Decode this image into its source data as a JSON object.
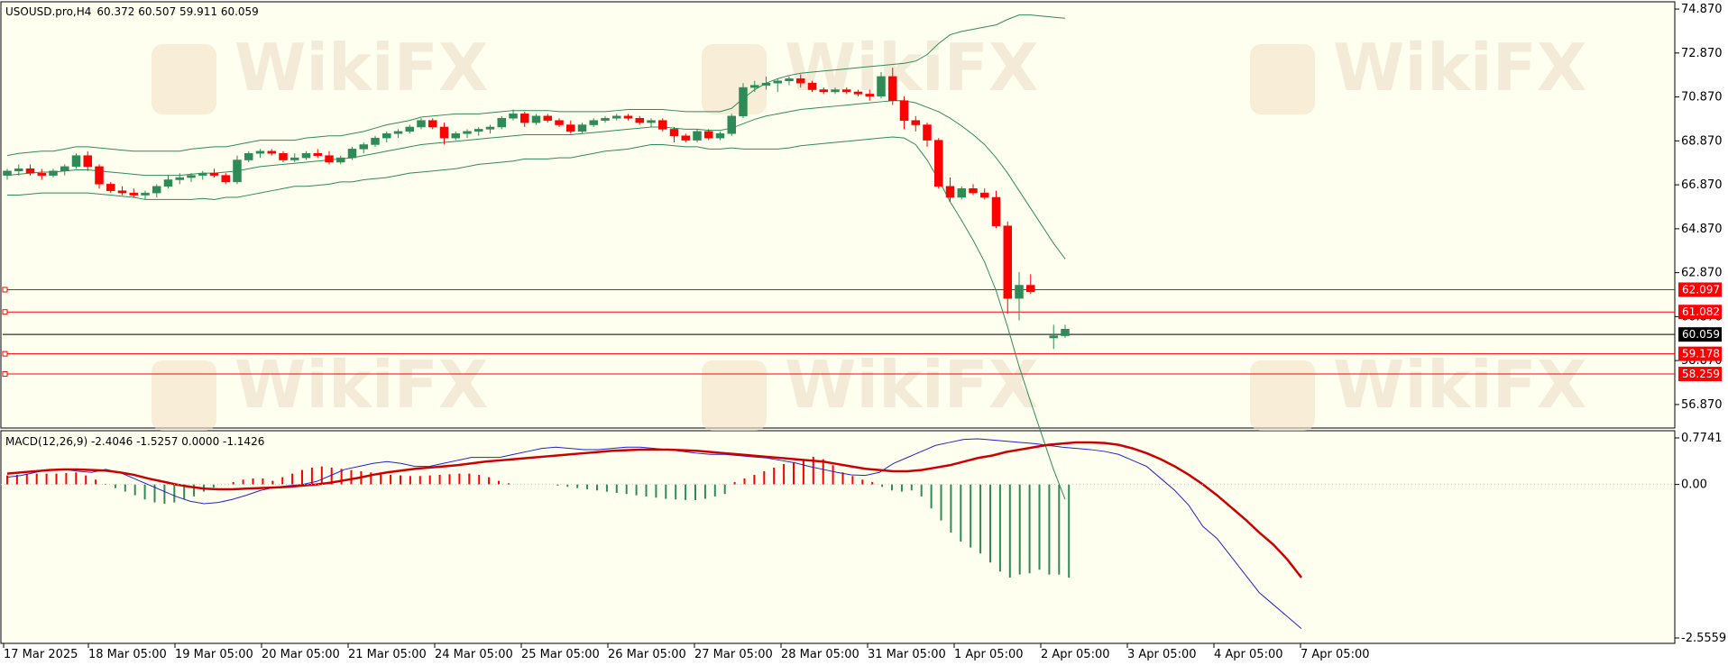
{
  "header": {
    "symbol_info": "USOUSD.pro,H4",
    "ohlc": "60.372 60.507 59.911 60.059",
    "macd_label": "MACD(12,26,9) -2.4046 -1.5257 0.0000 -1.1426"
  },
  "watermark": "WikiFX",
  "colors": {
    "background": "#fffff0",
    "bull": "#2e8b57",
    "bear": "#ff0000",
    "bands": "#2e8b57",
    "level_line": "#ff0000",
    "signal_line": "#cc0000",
    "macd_line": "#2222cc"
  },
  "chart_data": [
    {
      "type": "candlestick",
      "ylim": [
        55.8,
        75.2
      ],
      "y_ticks": [
        "74.870",
        "72.870",
        "70.870",
        "68.870",
        "66.870",
        "64.870",
        "62.870",
        "60.870",
        "58.870",
        "56.870"
      ],
      "price_tags": [
        {
          "label": "62.097",
          "value": 62.097,
          "kind": "level"
        },
        {
          "label": "61.082",
          "value": 61.082,
          "kind": "level"
        },
        {
          "label": "60.059",
          "value": 60.059,
          "kind": "current"
        },
        {
          "label": "59.178",
          "value": 59.178,
          "kind": "level"
        },
        {
          "label": "58.259",
          "value": 58.259,
          "kind": "level"
        }
      ],
      "x_labels": [
        "17 Mar 2025",
        "18 Mar 05:00",
        "19 Mar 05:00",
        "20 Mar 05:00",
        "21 Mar 05:00",
        "24 Mar 05:00",
        "25 Mar 05:00",
        "26 Mar 05:00",
        "27 Mar 05:00",
        "28 Mar 05:00",
        "31 Mar 05:00",
        "1 Apr 05:00",
        "2 Apr 05:00",
        "3 Apr 05:00",
        "4 Apr 05:00",
        "7 Apr 05:00"
      ],
      "candles": [
        [
          67.3,
          67.6,
          67.1,
          67.5
        ],
        [
          67.5,
          67.8,
          67.3,
          67.6
        ],
        [
          67.6,
          67.8,
          67.3,
          67.4
        ],
        [
          67.4,
          67.6,
          67.1,
          67.3
        ],
        [
          67.3,
          67.6,
          67.2,
          67.5
        ],
        [
          67.5,
          67.8,
          67.3,
          67.7
        ],
        [
          67.7,
          68.3,
          67.6,
          68.2
        ],
        [
          68.2,
          68.4,
          67.5,
          67.7
        ],
        [
          67.7,
          67.8,
          66.7,
          66.9
        ],
        [
          66.9,
          67.0,
          66.5,
          66.6
        ],
        [
          66.6,
          66.8,
          66.4,
          66.5
        ],
        [
          66.5,
          66.7,
          66.3,
          66.4
        ],
        [
          66.4,
          66.6,
          66.2,
          66.5
        ],
        [
          66.5,
          66.9,
          66.3,
          66.8
        ],
        [
          66.8,
          67.3,
          66.7,
          67.1
        ],
        [
          67.1,
          67.4,
          66.9,
          67.2
        ],
        [
          67.2,
          67.4,
          67.0,
          67.3
        ],
        [
          67.3,
          67.5,
          67.1,
          67.4
        ],
        [
          67.4,
          67.6,
          67.2,
          67.3
        ],
        [
          67.3,
          67.4,
          66.9,
          67.0
        ],
        [
          67.0,
          68.2,
          66.9,
          68.0
        ],
        [
          68.0,
          68.4,
          67.9,
          68.3
        ],
        [
          68.3,
          68.5,
          68.1,
          68.4
        ],
        [
          68.4,
          68.5,
          68.2,
          68.3
        ],
        [
          68.3,
          68.4,
          67.9,
          68.0
        ],
        [
          68.0,
          68.3,
          67.9,
          68.1
        ],
        [
          68.1,
          68.4,
          68.0,
          68.3
        ],
        [
          68.3,
          68.5,
          68.1,
          68.2
        ],
        [
          68.2,
          68.4,
          67.8,
          67.9
        ],
        [
          67.9,
          68.2,
          67.8,
          68.1
        ],
        [
          68.1,
          68.6,
          68.0,
          68.5
        ],
        [
          68.5,
          68.8,
          68.3,
          68.7
        ],
        [
          68.7,
          69.1,
          68.6,
          69.0
        ],
        [
          69.0,
          69.3,
          68.8,
          69.2
        ],
        [
          69.2,
          69.4,
          69.0,
          69.3
        ],
        [
          69.3,
          69.6,
          69.2,
          69.5
        ],
        [
          69.5,
          69.9,
          69.4,
          69.8
        ],
        [
          69.8,
          69.9,
          69.4,
          69.5
        ],
        [
          69.5,
          69.7,
          68.7,
          69.0
        ],
        [
          69.0,
          69.3,
          68.9,
          69.2
        ],
        [
          69.2,
          69.4,
          69.0,
          69.3
        ],
        [
          69.3,
          69.5,
          69.1,
          69.4
        ],
        [
          69.4,
          69.6,
          69.2,
          69.5
        ],
        [
          69.5,
          70.0,
          69.4,
          69.9
        ],
        [
          69.9,
          70.3,
          69.8,
          70.1
        ],
        [
          70.1,
          70.2,
          69.5,
          69.7
        ],
        [
          69.7,
          70.1,
          69.6,
          70.0
        ],
        [
          70.0,
          70.1,
          69.7,
          69.8
        ],
        [
          69.8,
          69.9,
          69.5,
          69.6
        ],
        [
          69.6,
          69.8,
          69.2,
          69.3
        ],
        [
          69.3,
          69.7,
          69.2,
          69.6
        ],
        [
          69.6,
          69.9,
          69.5,
          69.8
        ],
        [
          69.8,
          70.0,
          69.7,
          69.9
        ],
        [
          69.9,
          70.1,
          69.8,
          70.0
        ],
        [
          70.0,
          70.1,
          69.8,
          69.9
        ],
        [
          69.9,
          70.0,
          69.6,
          69.7
        ],
        [
          69.7,
          69.9,
          69.5,
          69.8
        ],
        [
          69.8,
          69.9,
          69.3,
          69.4
        ],
        [
          69.4,
          69.5,
          68.8,
          69.1
        ],
        [
          69.1,
          69.2,
          68.8,
          68.9
        ],
        [
          68.9,
          69.4,
          68.8,
          69.3
        ],
        [
          69.3,
          69.4,
          68.9,
          69.0
        ],
        [
          69.0,
          69.3,
          68.9,
          69.2
        ],
        [
          69.2,
          70.1,
          69.1,
          70.0
        ],
        [
          70.0,
          71.5,
          69.9,
          71.3
        ],
        [
          71.3,
          71.6,
          71.1,
          71.4
        ],
        [
          71.4,
          71.8,
          71.2,
          71.5
        ],
        [
          71.5,
          71.7,
          71.1,
          71.6
        ],
        [
          71.6,
          71.8,
          71.4,
          71.7
        ],
        [
          71.7,
          71.9,
          71.3,
          71.5
        ],
        [
          71.5,
          71.6,
          71.1,
          71.2
        ],
        [
          71.2,
          71.3,
          71.0,
          71.1
        ],
        [
          71.1,
          71.3,
          71.0,
          71.2
        ],
        [
          71.2,
          71.3,
          71.0,
          71.1
        ],
        [
          71.1,
          71.2,
          70.9,
          71.0
        ],
        [
          71.0,
          71.2,
          70.7,
          70.9
        ],
        [
          70.9,
          72.0,
          70.8,
          71.8
        ],
        [
          71.8,
          72.2,
          70.5,
          70.7
        ],
        [
          70.7,
          70.9,
          69.4,
          69.8
        ],
        [
          69.8,
          70.0,
          69.3,
          69.6
        ],
        [
          69.6,
          69.7,
          68.6,
          68.9
        ],
        [
          68.9,
          69.0,
          66.7,
          66.8
        ],
        [
          66.8,
          67.2,
          66.1,
          66.3
        ],
        [
          66.3,
          66.8,
          66.2,
          66.7
        ],
        [
          66.7,
          66.9,
          66.4,
          66.5
        ],
        [
          66.5,
          66.7,
          66.2,
          66.3
        ],
        [
          66.3,
          66.6,
          64.9,
          65.0
        ],
        [
          65.0,
          65.2,
          61.0,
          61.7
        ],
        [
          61.7,
          62.9,
          60.7,
          62.3
        ],
        [
          62.3,
          62.8,
          61.9,
          62.0
        ],
        [
          null,
          null,
          null,
          null
        ],
        [
          59.9,
          60.5,
          59.4,
          60.0
        ],
        [
          60.0,
          60.5,
          59.9,
          60.3
        ]
      ],
      "bollinger": {
        "upper": [
          68.2,
          68.3,
          68.35,
          68.4,
          68.4,
          68.5,
          68.6,
          68.6,
          68.55,
          68.5,
          68.45,
          68.4,
          68.4,
          68.4,
          68.4,
          68.4,
          68.5,
          68.55,
          68.6,
          68.6,
          68.7,
          68.8,
          68.9,
          68.9,
          68.9,
          68.9,
          69.0,
          69.05,
          69.1,
          69.1,
          69.2,
          69.3,
          69.45,
          69.6,
          69.7,
          69.8,
          69.95,
          70.0,
          70.05,
          70.1,
          70.1,
          70.1,
          70.15,
          70.2,
          70.25,
          70.25,
          70.25,
          70.25,
          70.2,
          70.2,
          70.2,
          70.2,
          70.2,
          70.25,
          70.3,
          70.3,
          70.3,
          70.3,
          70.25,
          70.2,
          70.2,
          70.2,
          70.2,
          70.35,
          70.8,
          71.2,
          71.5,
          71.7,
          71.85,
          71.95,
          72.0,
          72.05,
          72.1,
          72.15,
          72.2,
          72.25,
          72.3,
          72.35,
          72.4,
          72.5,
          72.8,
          73.3,
          73.7,
          73.85,
          73.95,
          74.05,
          74.15,
          74.4,
          74.6,
          74.6,
          74.55,
          74.5,
          74.45
        ],
        "middle": [
          67.3,
          67.35,
          67.4,
          67.45,
          67.45,
          67.5,
          67.55,
          67.55,
          67.5,
          67.45,
          67.4,
          67.35,
          67.3,
          67.3,
          67.3,
          67.3,
          67.35,
          67.4,
          67.4,
          67.45,
          67.5,
          67.6,
          67.7,
          67.75,
          67.8,
          67.85,
          67.9,
          67.95,
          68.0,
          68.05,
          68.1,
          68.2,
          68.3,
          68.4,
          68.5,
          68.6,
          68.7,
          68.75,
          68.8,
          68.85,
          68.9,
          68.95,
          69.0,
          69.05,
          69.1,
          69.15,
          69.15,
          69.15,
          69.15,
          69.15,
          69.2,
          69.25,
          69.3,
          69.35,
          69.4,
          69.45,
          69.5,
          69.5,
          69.45,
          69.4,
          69.4,
          69.35,
          69.35,
          69.45,
          69.65,
          69.85,
          70.0,
          70.1,
          70.2,
          70.3,
          70.35,
          70.4,
          70.45,
          70.5,
          70.55,
          70.6,
          70.65,
          70.7,
          70.7,
          70.6,
          70.4,
          70.2,
          69.9,
          69.55,
          69.15,
          68.7,
          68.1,
          67.4,
          66.6,
          65.8,
          65.0,
          64.2,
          63.5
        ],
        "lower": [
          66.4,
          66.4,
          66.45,
          66.5,
          66.5,
          66.5,
          66.5,
          66.5,
          66.45,
          66.4,
          66.35,
          66.3,
          66.2,
          66.2,
          66.2,
          66.2,
          66.2,
          66.25,
          66.2,
          66.3,
          66.3,
          66.4,
          66.5,
          66.6,
          66.7,
          66.8,
          66.8,
          66.85,
          66.9,
          67.0,
          67.0,
          67.1,
          67.15,
          67.2,
          67.3,
          67.4,
          67.45,
          67.5,
          67.55,
          67.6,
          67.7,
          67.8,
          67.85,
          67.9,
          67.95,
          68.05,
          68.05,
          68.05,
          68.1,
          68.1,
          68.2,
          68.3,
          68.4,
          68.45,
          68.5,
          68.6,
          68.7,
          68.7,
          68.65,
          68.6,
          68.6,
          68.5,
          68.5,
          68.55,
          68.5,
          68.5,
          68.5,
          68.5,
          68.55,
          68.65,
          68.7,
          68.75,
          68.8,
          68.85,
          68.9,
          68.95,
          69.0,
          69.05,
          69.0,
          68.7,
          68.0,
          67.1,
          66.1,
          65.25,
          64.35,
          63.35,
          62.05,
          60.4,
          58.6,
          57.0,
          55.45,
          53.9,
          52.55
        ]
      }
    },
    {
      "type": "macd",
      "ylim": [
        -2.5559,
        0.7741
      ],
      "y_ticks": [
        "0.7741",
        "0.00",
        "-2.5559"
      ],
      "histogram": [
        0.15,
        0.16,
        0.17,
        0.18,
        0.18,
        0.18,
        0.19,
        0.2,
        0.15,
        0.08,
        0.01,
        -0.06,
        -0.12,
        -0.18,
        -0.25,
        -0.3,
        -0.32,
        -0.3,
        -0.25,
        -0.2,
        -0.12,
        -0.05,
        0.0,
        0.04,
        0.08,
        0.1,
        0.1,
        0.06,
        0.12,
        0.18,
        0.24,
        0.28,
        0.3,
        0.28,
        0.26,
        0.24,
        0.22,
        0.2,
        0.18,
        0.16,
        0.15,
        0.14,
        0.14,
        0.15,
        0.16,
        0.17,
        0.18,
        0.18,
        0.16,
        0.12,
        0.06,
        0.02,
        0.0,
        0.0,
        0.0,
        0.0,
        -0.02,
        -0.04,
        -0.06,
        -0.08,
        -0.1,
        -0.12,
        -0.14,
        -0.16,
        -0.18,
        -0.2,
        -0.22,
        -0.24,
        -0.25,
        -0.26,
        -0.26,
        -0.24,
        -0.2,
        -0.16,
        0.04,
        0.1,
        0.16,
        0.22,
        0.28,
        0.34,
        0.36,
        0.4,
        0.46,
        0.42,
        0.32,
        0.2,
        0.14,
        0.08,
        0.04,
        -0.04,
        -0.1,
        -0.12,
        -0.1,
        -0.2,
        -0.4,
        -0.6,
        -0.8,
        -0.95,
        -1.05,
        -1.15,
        -1.3,
        -1.45,
        -1.55,
        -1.5,
        -1.48,
        -1.42,
        -1.5,
        -1.5,
        -1.55
      ],
      "macd_line": [
        0.12,
        0.15,
        0.2,
        0.25,
        0.25,
        0.22,
        0.2,
        0.25,
        0.2,
        0.1,
        0.0,
        -0.1,
        -0.2,
        -0.28,
        -0.32,
        -0.3,
        -0.25,
        -0.18,
        -0.1,
        -0.05,
        -0.02,
        0.0,
        0.05,
        0.15,
        0.25,
        0.3,
        0.35,
        0.38,
        0.35,
        0.3,
        0.3,
        0.35,
        0.4,
        0.45,
        0.45,
        0.45,
        0.5,
        0.55,
        0.6,
        0.62,
        0.6,
        0.58,
        0.58,
        0.6,
        0.62,
        0.62,
        0.6,
        0.58,
        0.55,
        0.52,
        0.5,
        0.5,
        0.48,
        0.46,
        0.44,
        0.4,
        0.36,
        0.3,
        0.25,
        0.2,
        0.16,
        0.15,
        0.2,
        0.35,
        0.45,
        0.55,
        0.65,
        0.7,
        0.75,
        0.76,
        0.74,
        0.72,
        0.7,
        0.68,
        0.65,
        0.62,
        0.6,
        0.58,
        0.55,
        0.5,
        0.4,
        0.3,
        0.1,
        -0.1,
        -0.35,
        -0.7,
        -0.9,
        -1.2,
        -1.5,
        -1.8,
        -2.0,
        -2.2,
        -2.4
      ],
      "signal_line": [
        0.18,
        0.2,
        0.22,
        0.24,
        0.25,
        0.25,
        0.24,
        0.23,
        0.2,
        0.16,
        0.1,
        0.05,
        0.0,
        -0.04,
        -0.07,
        -0.08,
        -0.08,
        -0.07,
        -0.06,
        -0.05,
        -0.04,
        -0.02,
        0.0,
        0.03,
        0.07,
        0.11,
        0.16,
        0.2,
        0.23,
        0.26,
        0.28,
        0.3,
        0.32,
        0.35,
        0.38,
        0.4,
        0.42,
        0.44,
        0.46,
        0.48,
        0.5,
        0.52,
        0.54,
        0.56,
        0.57,
        0.58,
        0.58,
        0.58,
        0.57,
        0.56,
        0.54,
        0.52,
        0.5,
        0.48,
        0.46,
        0.44,
        0.42,
        0.4,
        0.38,
        0.34,
        0.3,
        0.26,
        0.24,
        0.22,
        0.22,
        0.24,
        0.28,
        0.32,
        0.38,
        0.44,
        0.48,
        0.54,
        0.58,
        0.62,
        0.66,
        0.68,
        0.7,
        0.7,
        0.69,
        0.66,
        0.6,
        0.52,
        0.42,
        0.3,
        0.16,
        0.0,
        -0.18,
        -0.38,
        -0.58,
        -0.8,
        -1.0,
        -1.25,
        -1.55
      ]
    }
  ]
}
